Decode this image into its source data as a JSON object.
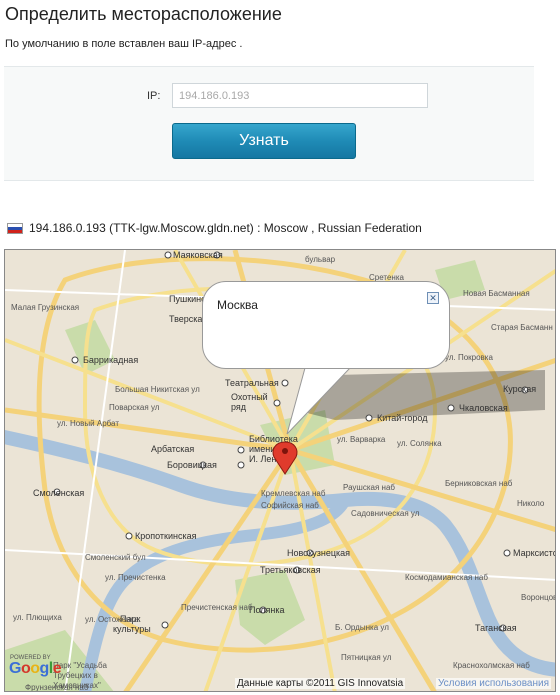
{
  "page": {
    "title": "Определить месторасположение",
    "intro": "По умолчанию в поле вставлен ваш IP-адрес ."
  },
  "form": {
    "ip_label": "IP:",
    "ip_placeholder": "194.186.0.193",
    "submit_label": "Узнать"
  },
  "result": {
    "flag_icon": "russia-flag-icon",
    "text": "194.186.0.193 (TTK-lgw.Moscow.gldn.net) : Moscow , Russian Federation"
  },
  "map": {
    "info_window": {
      "title": "Москва",
      "close_icon": "close-icon"
    },
    "marker_icon": "map-pin-icon",
    "powered_by": "POWERED BY",
    "logo": "Google",
    "copyright": "Данные карты ©2011 GIS Innovatsia",
    "terms": "Условия использования",
    "labels": {
      "mayakovskaya": "Маяковская",
      "pushkinskaya": "Пушкинска",
      "tverskaya": "Тверская",
      "barrikadnaya": "Баррикадная",
      "teatralnaya": "Театральная",
      "okhotny": "Охотный",
      "ryad": "ряд",
      "biblioteka": "Библиотека",
      "imeni": "имени",
      "lenina": "И. Ленина",
      "arbatskaya": "Арбатская",
      "borovitskaya": "Боровицкая",
      "smolenskaya": "Смоленская",
      "kropotkinskaya": "Кропоткинская",
      "kitay_gorod": "Китай-город",
      "kurskaya": "Курская",
      "chkalovskaya": "Чкаловская",
      "novokuznetskaya": "Новокузнецкая",
      "tretyakovskaya": "Третьяковская",
      "polyanka": "Полянка",
      "park_kultury_1": "Парк",
      "park_kultury_2": "культуры",
      "taganskaya": "Таганская",
      "marksistskaya": "Марксистская",
      "nov_arbat": "ул. Новый Арбат",
      "varvarka": "ул. Варварка",
      "solyanka": "ул. Солянка",
      "b_nikitskaya": "Большая Никитская ул",
      "povarskaya": "Поварская ул",
      "prechistenka": "ул. Пречистенка",
      "ostozhenka": "ул. Остоженка",
      "kremlevskaya": "Кремлевская наб",
      "sofiyskaya": "Софийская наб",
      "raushskaya": "Раушская наб",
      "sadovnicheskaya": "Садовническая ул",
      "kosmodamianskaya": "Космодамианская наб",
      "b_ordynka": "Б. Ордынка ул",
      "pyatnitskaya": "Пятницкая ул",
      "n_basmannaya": "Новая Басманная",
      "st_basmannaya": "Старая Басманн",
      "pokrovka": "ул. Покровка",
      "berniikovskaya": "Берниковская наб",
      "nikolo": "Николо",
      "prechistenskaya": "Пречистенская наб",
      "frunzenskaya": "Фрунзенская наб",
      "smolensky_bul": "Смоленский бул",
      "pliushchikha": "ул. Плющиха",
      "bulvar": "бульвар",
      "sretenka": "Сретенка",
      "malaya_gruzinskaya": "Малая Грузинская",
      "usadba_1": "Парк \"Усадьба",
      "usadba_2": "Трубецких в",
      "usadba_3": "Хамовниках\"",
      "kosmodamianskaya_2": "Краснохолмская наб",
      "vorontsovskaya": "Воронцовская"
    }
  }
}
